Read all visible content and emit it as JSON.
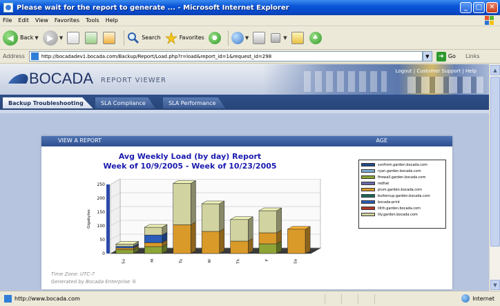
{
  "window": {
    "title": "Please wait for the report to generate ... - Microsoft Internet Explorer",
    "minimize": "_",
    "maximize": "□",
    "close": "✕"
  },
  "menu": [
    "File",
    "Edit",
    "View",
    "Favorites",
    "Tools",
    "Help"
  ],
  "toolbar": {
    "back": "Back",
    "search": "Search",
    "favorites": "Favorites"
  },
  "address": {
    "label": "Address",
    "url": "http://bocadadev1.bocada.com/Backup/Report/Load.php?r=load&report_id=1&request_id=298",
    "go": "Go",
    "links": "Links"
  },
  "site": {
    "logo": "BOCADA",
    "logo_sub": "REPORT VIEWER",
    "header_links": "Logout | Customer Support | Help",
    "tabs": [
      {
        "label": "Backup Troubleshooting",
        "active": true
      },
      {
        "label": "SLA Compliance",
        "active": false
      },
      {
        "label": "SLA Performance",
        "active": false
      }
    ]
  },
  "report": {
    "bar_left": "VIEW A REPORT",
    "bar_right": "AGE",
    "title": "Avg Weekly Load (by day) Report",
    "subtitle": "Week of 10/9/2005 - Week of 10/23/2005",
    "footer_line1": "Time Zone: UTC-7",
    "footer_line2": "Generated by Bocada Enterprise ®"
  },
  "chart_data": {
    "type": "bar",
    "stacked": true,
    "ylabel": "Gigabytes",
    "yticks": [
      "250",
      "200",
      "150",
      "100",
      "50",
      "0"
    ],
    "ylim": [
      0,
      250
    ],
    "grid": true,
    "legend_position": "right",
    "categories": [
      "Su",
      "M",
      "Tu",
      "W",
      "Th",
      "F",
      "Sa"
    ],
    "series": [
      {
        "name": "sunfrom.garden.bocada.com",
        "color": "#234a8c",
        "values": [
          0,
          0,
          0,
          0,
          0,
          0,
          0
        ]
      },
      {
        "name": "ryan.garden.bocada.com",
        "color": "#7faed8",
        "values": [
          0,
          0,
          0,
          0,
          0,
          0,
          0
        ]
      },
      {
        "name": "firewall.garden.bocada.com",
        "color": "#8da437",
        "values": [
          14,
          25,
          0,
          0,
          0,
          35,
          0
        ]
      },
      {
        "name": "redhat",
        "color": "#6a6aa8",
        "values": [
          0,
          0,
          0,
          0,
          0,
          0,
          0
        ]
      },
      {
        "name": "plum.garden.bocada.com",
        "color": "#d99a2a",
        "values": [
          6,
          14,
          104,
          80,
          45,
          40,
          88
        ]
      },
      {
        "name": "buttercup.garden.bocada.com",
        "color": "#1d6b5a",
        "values": [
          0,
          0,
          0,
          0,
          0,
          0,
          0
        ]
      },
      {
        "name": "bocada-print",
        "color": "#2a5cb8",
        "values": [
          6,
          28,
          0,
          0,
          0,
          0,
          0
        ]
      },
      {
        "name": "lilith.garden.bocada.com",
        "color": "#b03a2e",
        "values": [
          0,
          0,
          0,
          0,
          0,
          0,
          0
        ]
      },
      {
        "name": "lily.garden.bocada.com",
        "color": "#d1d3a0",
        "values": [
          8,
          28,
          150,
          100,
          78,
          80,
          0
        ]
      }
    ]
  },
  "status": {
    "left": "http://www.bocada.com",
    "zone": "Internet"
  }
}
